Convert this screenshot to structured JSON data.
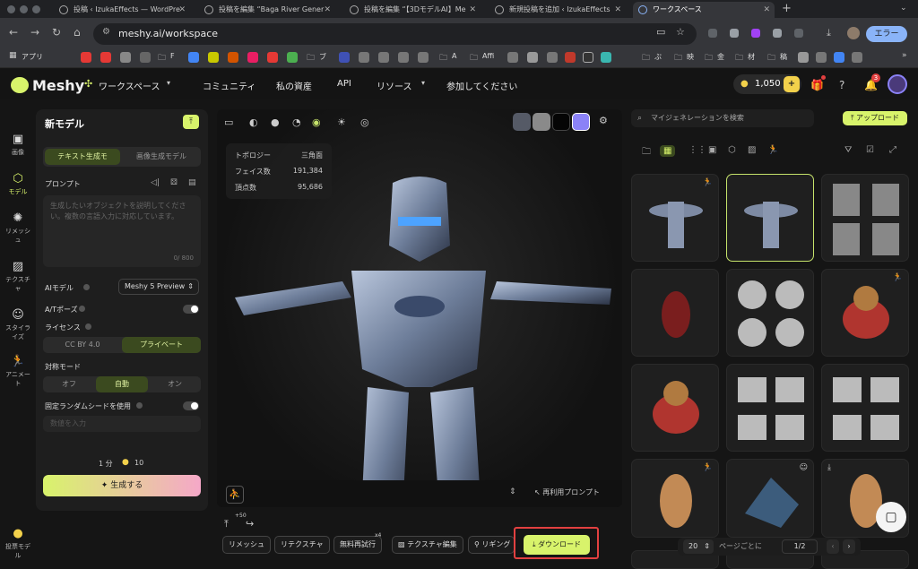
{
  "browser": {
    "tabs": [
      {
        "label": "投稿 ‹ IzukaEffects — WordPre"
      },
      {
        "label": "投稿を編集 “Baga River Gener"
      },
      {
        "label": "投稿を編集 “【3DモデルAI】Me"
      },
      {
        "label": "新規投稿を追加 ‹ IzukaEffects"
      },
      {
        "label": "ワークスペース"
      }
    ],
    "url": "meshy.ai/workspace",
    "error_label": "エラー",
    "bookmarks_apps": "アプリ",
    "bookmarks": [
      "F",
      "ブ",
      "A",
      "Affi",
      "ぶ",
      "映",
      "金",
      "材",
      "稿"
    ]
  },
  "header": {
    "logo": "Meshy",
    "workspace": "ワークスペース",
    "nav": [
      "コミュニティ",
      "私の資産",
      "API",
      "リソース",
      "参加してください"
    ],
    "credits": "1,050",
    "notifications": "3"
  },
  "rail": [
    {
      "label": "画像",
      "icon": "image-icon"
    },
    {
      "label": "モデル",
      "icon": "cube-icon"
    },
    {
      "label": "リメッシュ",
      "icon": "remesh-icon"
    },
    {
      "label": "テクスチャ",
      "icon": "texture-icon"
    },
    {
      "label": "スタイライズ",
      "icon": "stylize-icon"
    },
    {
      "label": "アニメート",
      "icon": "animate-icon"
    },
    {
      "label": "投票モデル",
      "icon": "vote-icon"
    }
  ],
  "panel": {
    "title": "新モデル",
    "tab_text": "テキスト生成モ",
    "tab_image": "画像生成モデル",
    "prompt_label": "プロンプト",
    "prompt_placeholder": "生成したいオブジェクトを説明してください。複数の言語入力に対応しています。",
    "prompt_count": "0/ 800",
    "ai_model_label": "AIモデル",
    "ai_model_value": "Meshy 5 Preview",
    "at_pose_label": "A/Tポーズ",
    "license_label": "ライセンス",
    "license_cc": "CC BY 4.0",
    "license_private": "プライベート",
    "symmetry_label": "対称モード",
    "sym_off": "オフ",
    "sym_auto": "自動",
    "sym_on": "オン",
    "seed_label": "固定ランダムシードを使用",
    "seed_placeholder": "数値を入力",
    "time": "1 分",
    "cost": "10",
    "generate": "生成する"
  },
  "viewport": {
    "stats": [
      {
        "k": "トポロジー",
        "v": "三角面"
      },
      {
        "k": "フェイス数",
        "v": "191,384"
      },
      {
        "k": "頂点数",
        "v": "95,686"
      }
    ],
    "swatches": [
      "#555a66",
      "#8a8a8a",
      "#050505",
      "#8b82f7"
    ],
    "reuse_prompt": "再利用プロンプト",
    "badge_50": "+50",
    "badge_x4": "x4",
    "actions": [
      "リメッシュ",
      "リテクスチャ",
      "無料再試行",
      "テクスチャ編集",
      "リギング"
    ],
    "download": "ダウンロード"
  },
  "right": {
    "search_placeholder": "マイジェネレーションを検索",
    "upload": "アップロード",
    "page_size": "20",
    "per_page": "ページごとに",
    "page": "1/2"
  }
}
